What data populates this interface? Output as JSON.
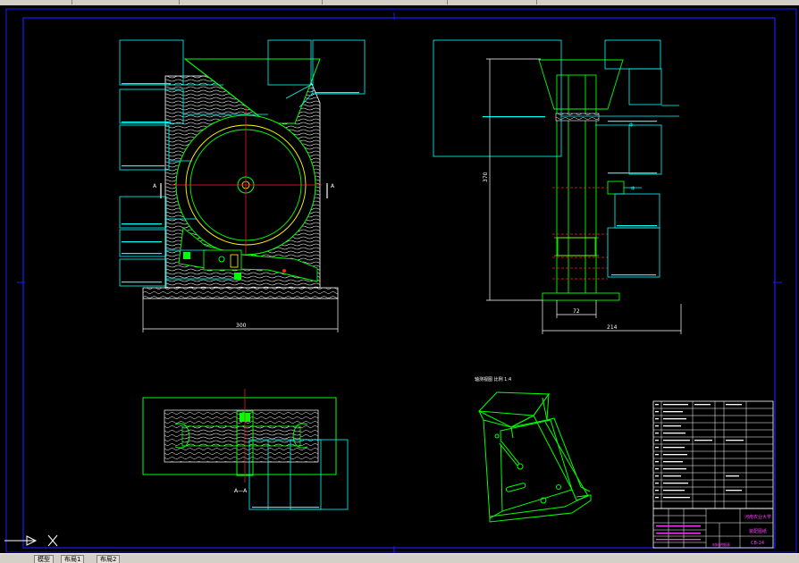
{
  "drawing": {
    "dimensions": {
      "front_width": "300",
      "side_height": "370",
      "side_base_inner": "72",
      "side_base_outer": "214"
    },
    "section_labels": {
      "left_a": "A",
      "right_a": "A",
      "section_aa": "A—A"
    },
    "iso_caption": "轴测视图  比例 1:4",
    "title_block": {
      "school": "河南农业大学",
      "drawing_name": "装配图纸",
      "drawing_no": "CB-24",
      "drawer": "材料明细表"
    }
  },
  "ui": {
    "tabs": [
      "模型",
      "布局1",
      "布局2"
    ]
  },
  "colors": {
    "border": "#1a1aff",
    "line_green": "#00ff00",
    "line_cyan": "#00ffff",
    "line_yellow": "#ffff00",
    "line_red": "#ff2020",
    "line_white": "#ffffff",
    "text_magenta": "#ff40ff"
  }
}
